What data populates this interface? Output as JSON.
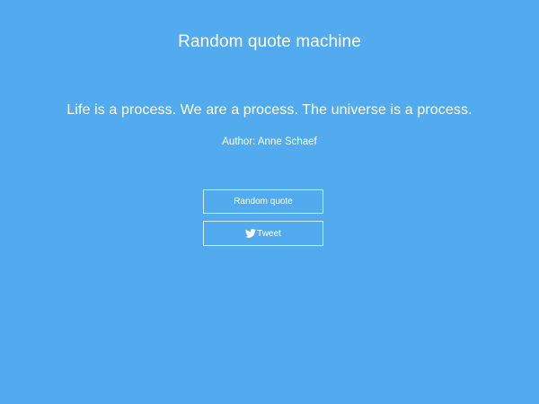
{
  "app": {
    "title": "Random quote machine"
  },
  "quote": {
    "text": "Life is a process. We are a process. The universe is a process.",
    "author": "Author: Anne Schaef"
  },
  "buttons": {
    "random_label": "Random quote",
    "tweet_label": "Tweet",
    "tweet_icon": "twitter-icon"
  },
  "colors": {
    "background": "#52abef",
    "text": "#ffffff"
  }
}
